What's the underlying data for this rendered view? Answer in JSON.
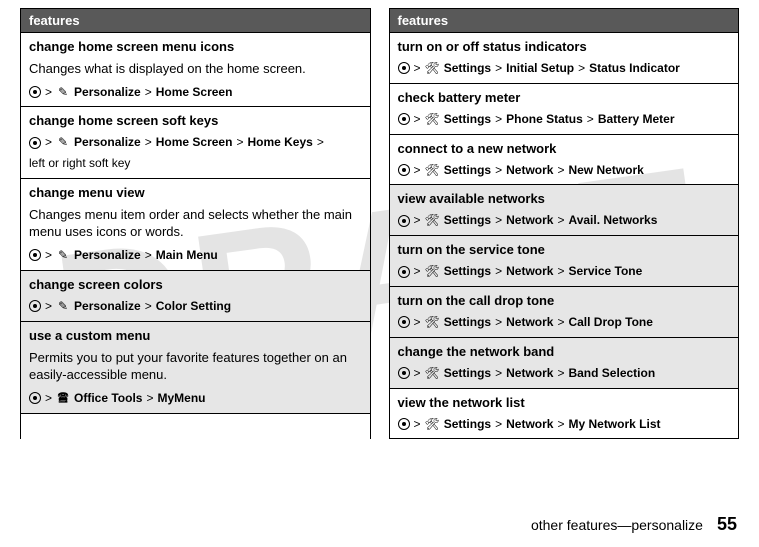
{
  "watermark": "DRAFT",
  "footer": {
    "text": "other features—personalize",
    "page": "55"
  },
  "header": "features",
  "sep": ">",
  "left": [
    {
      "title": "change home screen menu icons",
      "desc": "Changes what is displayed on the home screen.",
      "path": [
        {
          "t": "center"
        },
        {
          "t": "sep"
        },
        {
          "t": "icon",
          "v": "✎"
        },
        {
          "t": "b",
          "v": "Personalize"
        },
        {
          "t": "sep"
        },
        {
          "t": "b",
          "v": "Home Screen"
        }
      ]
    },
    {
      "title": "change home screen soft keys",
      "path": [
        {
          "t": "center"
        },
        {
          "t": "sep"
        },
        {
          "t": "icon",
          "v": "✎"
        },
        {
          "t": "b",
          "v": "Personalize"
        },
        {
          "t": "sep"
        },
        {
          "t": "b",
          "v": "Home Screen"
        },
        {
          "t": "sep"
        },
        {
          "t": "b",
          "v": "Home Keys"
        },
        {
          "t": "sep"
        },
        {
          "t": "r",
          "v": "left or right soft key"
        }
      ]
    },
    {
      "title": "change menu view",
      "desc": "Changes menu item order and selects whether the main menu uses icons or words.",
      "path": [
        {
          "t": "center"
        },
        {
          "t": "sep"
        },
        {
          "t": "icon",
          "v": "✎"
        },
        {
          "t": "b",
          "v": "Personalize"
        },
        {
          "t": "sep"
        },
        {
          "t": "b",
          "v": "Main Menu"
        }
      ]
    },
    {
      "title": "change screen colors",
      "shade": true,
      "path": [
        {
          "t": "center"
        },
        {
          "t": "sep"
        },
        {
          "t": "icon",
          "v": "✎"
        },
        {
          "t": "b",
          "v": "Personalize"
        },
        {
          "t": "sep"
        },
        {
          "t": "b",
          "v": "Color Setting"
        }
      ]
    },
    {
      "title": "use a custom menu",
      "shade": true,
      "desc": "Permits you to put your favorite features together on an easily-accessible menu.",
      "path": [
        {
          "t": "center"
        },
        {
          "t": "sep"
        },
        {
          "t": "icon",
          "v": "🖀"
        },
        {
          "t": "b",
          "v": "Office Tools"
        },
        {
          "t": "sep"
        },
        {
          "t": "b",
          "v": "MyMenu"
        }
      ]
    }
  ],
  "right": [
    {
      "title": "turn on or off status indicators",
      "path": [
        {
          "t": "center"
        },
        {
          "t": "sep"
        },
        {
          "t": "icon",
          "v": "🛠"
        },
        {
          "t": "b",
          "v": "Settings"
        },
        {
          "t": "sep"
        },
        {
          "t": "b",
          "v": "Initial Setup"
        },
        {
          "t": "sep"
        },
        {
          "t": "b",
          "v": "Status Indicator"
        }
      ]
    },
    {
      "title": "check battery meter",
      "path": [
        {
          "t": "center"
        },
        {
          "t": "sep"
        },
        {
          "t": "icon",
          "v": "🛠"
        },
        {
          "t": "b",
          "v": "Settings"
        },
        {
          "t": "sep"
        },
        {
          "t": "b",
          "v": "Phone Status"
        },
        {
          "t": "sep"
        },
        {
          "t": "b",
          "v": "Battery Meter"
        }
      ]
    },
    {
      "title": "connect to a new network",
      "path": [
        {
          "t": "center"
        },
        {
          "t": "sep"
        },
        {
          "t": "icon",
          "v": "🛠"
        },
        {
          "t": "b",
          "v": "Settings"
        },
        {
          "t": "sep"
        },
        {
          "t": "b",
          "v": "Network"
        },
        {
          "t": "sep"
        },
        {
          "t": "b",
          "v": "New Network"
        }
      ]
    },
    {
      "title": "view available networks",
      "shade": true,
      "path": [
        {
          "t": "center"
        },
        {
          "t": "sep"
        },
        {
          "t": "icon",
          "v": "🛠"
        },
        {
          "t": "b",
          "v": "Settings"
        },
        {
          "t": "sep"
        },
        {
          "t": "b",
          "v": "Network"
        },
        {
          "t": "sep"
        },
        {
          "t": "b",
          "v": "Avail. Networks"
        }
      ]
    },
    {
      "title": "turn on the service tone",
      "shade": true,
      "path": [
        {
          "t": "center"
        },
        {
          "t": "sep"
        },
        {
          "t": "icon",
          "v": "🛠"
        },
        {
          "t": "b",
          "v": "Settings"
        },
        {
          "t": "sep"
        },
        {
          "t": "b",
          "v": "Network"
        },
        {
          "t": "sep"
        },
        {
          "t": "b",
          "v": "Service Tone"
        }
      ]
    },
    {
      "title": "turn on the call drop tone",
      "shade": true,
      "path": [
        {
          "t": "center"
        },
        {
          "t": "sep"
        },
        {
          "t": "icon",
          "v": "🛠"
        },
        {
          "t": "b",
          "v": "Settings"
        },
        {
          "t": "sep"
        },
        {
          "t": "b",
          "v": "Network"
        },
        {
          "t": "sep"
        },
        {
          "t": "b",
          "v": "Call Drop Tone"
        }
      ]
    },
    {
      "title": "change the network band",
      "shade": true,
      "path": [
        {
          "t": "center"
        },
        {
          "t": "sep"
        },
        {
          "t": "icon",
          "v": "🛠"
        },
        {
          "t": "b",
          "v": "Settings"
        },
        {
          "t": "sep"
        },
        {
          "t": "b",
          "v": "Network"
        },
        {
          "t": "sep"
        },
        {
          "t": "b",
          "v": "Band Selection"
        }
      ]
    },
    {
      "title": "view the network list",
      "path": [
        {
          "t": "center"
        },
        {
          "t": "sep"
        },
        {
          "t": "icon",
          "v": "🛠"
        },
        {
          "t": "b",
          "v": "Settings"
        },
        {
          "t": "sep"
        },
        {
          "t": "b",
          "v": "Network"
        },
        {
          "t": "sep"
        },
        {
          "t": "b",
          "v": "My Network List"
        }
      ]
    }
  ]
}
